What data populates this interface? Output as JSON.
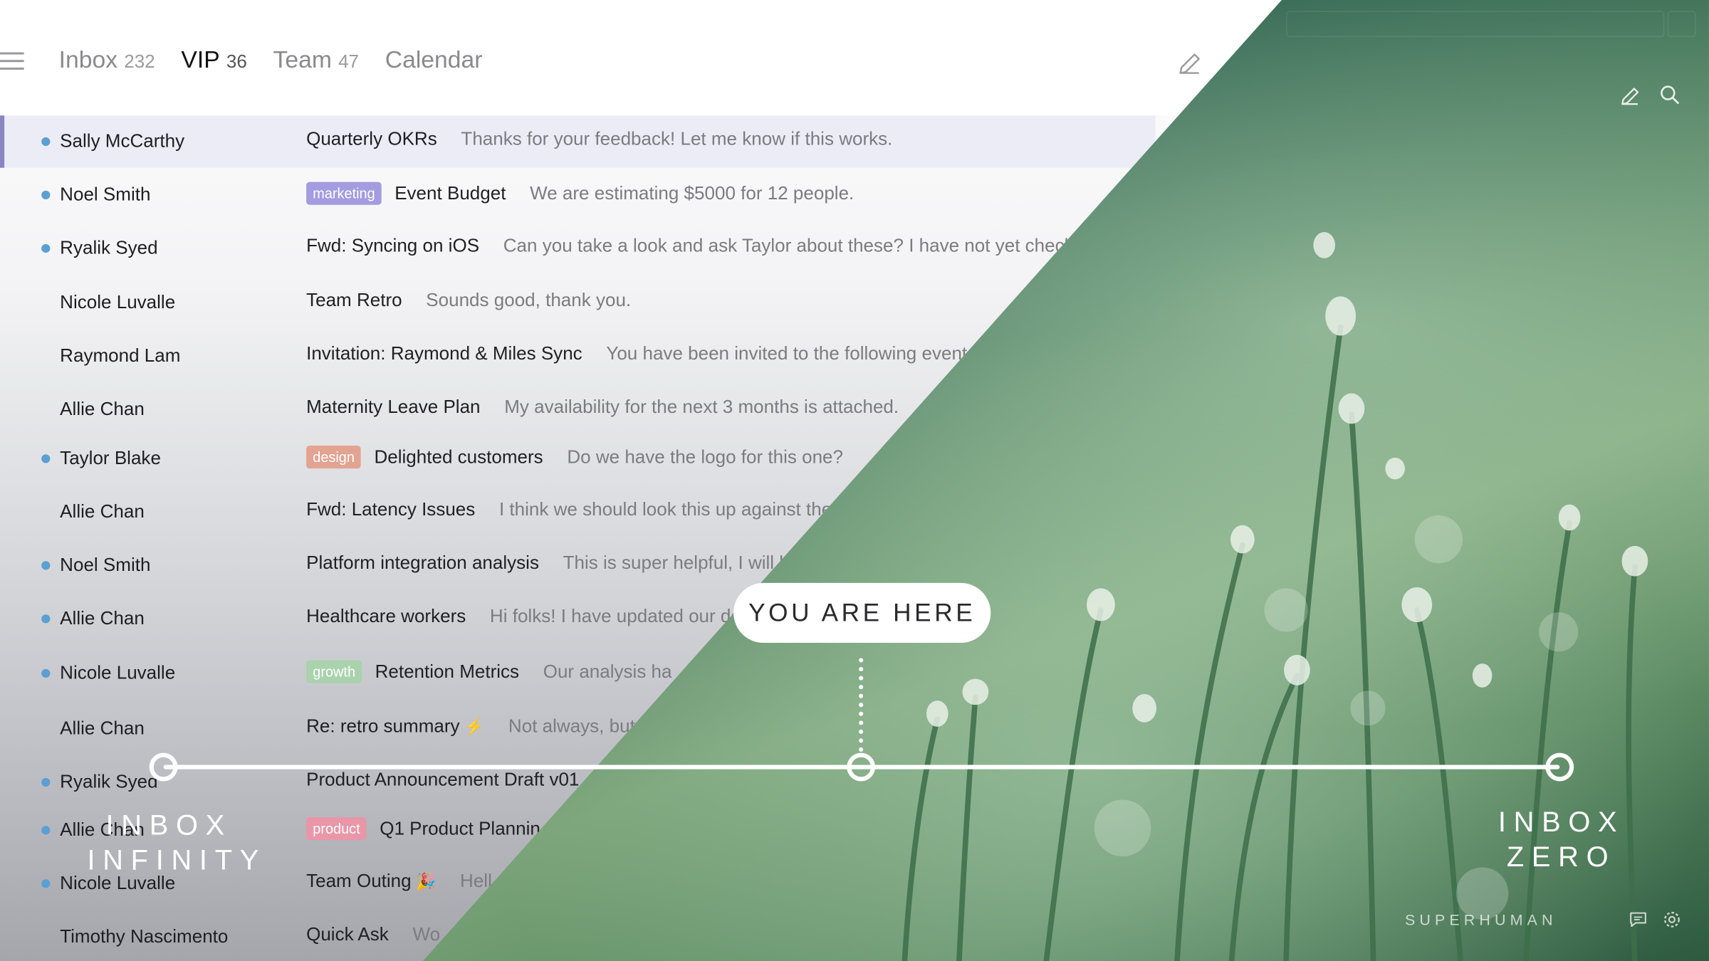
{
  "tabs": [
    {
      "label": "Inbox",
      "count": "232"
    },
    {
      "label": "VIP",
      "count": "36"
    },
    {
      "label": "Team",
      "count": "47"
    },
    {
      "label": "Calendar",
      "count": ""
    }
  ],
  "rows": [
    {
      "sender": "Sally McCarthy",
      "unread": true,
      "label": "",
      "subject": "Quarterly OKRs",
      "preview": "Thanks for your feedback! Let me know if this works."
    },
    {
      "sender": "Noel Smith",
      "unread": true,
      "label": "marketing",
      "subject": "Event Budget",
      "preview": "We are estimating $5000 for 12 people."
    },
    {
      "sender": "Ryalik Syed",
      "unread": true,
      "label": "",
      "subject": "Fwd: Syncing on iOS",
      "preview": "Can you take a look and ask Taylor about these? I have not yet checked"
    },
    {
      "sender": "Nicole Luvalle",
      "unread": false,
      "label": "",
      "subject": "Team Retro",
      "preview": "Sounds good, thank you."
    },
    {
      "sender": "Raymond Lam",
      "unread": false,
      "label": "",
      "subject": "Invitation: Raymond & Miles Sync",
      "preview": "You have been invited to the following event."
    },
    {
      "sender": "Allie Chan",
      "unread": false,
      "label": "",
      "subject": "Maternity Leave Plan",
      "preview": "My availability for the next 3 months is attached."
    },
    {
      "sender": "Taylor Blake",
      "unread": true,
      "label": "design",
      "subject": "Delighted customers",
      "preview": "Do we have the logo for this one?"
    },
    {
      "sender": "Allie Chan",
      "unread": false,
      "label": "",
      "subject": "Fwd: Latency Issues",
      "preview": "I think we should look this up against the"
    },
    {
      "sender": "Noel Smith",
      "unread": true,
      "label": "",
      "subject": "Platform integration analysis",
      "preview": "This is super helpful, I will l"
    },
    {
      "sender": "Allie Chan",
      "unread": true,
      "label": "",
      "subject": "Healthcare workers",
      "preview": "Hi folks! I have updated our do"
    },
    {
      "sender": "Nicole Luvalle",
      "unread": true,
      "label": "growth",
      "subject": "Retention Metrics",
      "preview": "Our analysis ha"
    },
    {
      "sender": "Allie Chan",
      "unread": false,
      "label": "",
      "subject": "Re: retro summary",
      "emoji": "⚡",
      "preview": "Not always, but"
    },
    {
      "sender": "Ryalik Syed",
      "unread": true,
      "label": "",
      "subject": "Product Announcement Draft v01",
      "preview": ""
    },
    {
      "sender": "Allie Chan",
      "unread": true,
      "label": "product",
      "subject": "Q1 Product Plannin",
      "preview": ""
    },
    {
      "sender": "Nicole Luvalle",
      "unread": true,
      "label": "",
      "subject": "Team Outing",
      "emoji": "🎉",
      "preview": "Hell"
    },
    {
      "sender": "Timothy Nascimento",
      "unread": false,
      "label": "",
      "subject": "Quick Ask",
      "preview": "Wo"
    }
  ],
  "label_colors": {
    "marketing": "#a49be0",
    "design": "#e2a391",
    "growth": "#a9d2ad",
    "product": "#e896a8"
  },
  "overlay": {
    "you_are_here": "YOU ARE HERE",
    "inbox_infinity": "INBOX\nINFINITY",
    "inbox_zero": "INBOX\nZERO",
    "brand": "SUPERHUMAN"
  },
  "icons": {
    "menu": "menu-icon",
    "compose": "pencil-icon",
    "search": "search-icon",
    "chat": "chat-icon",
    "settings": "gear-icon"
  },
  "colors": {
    "unread_dot": "#5b9fd3",
    "selected_accent": "#8a86c4"
  }
}
